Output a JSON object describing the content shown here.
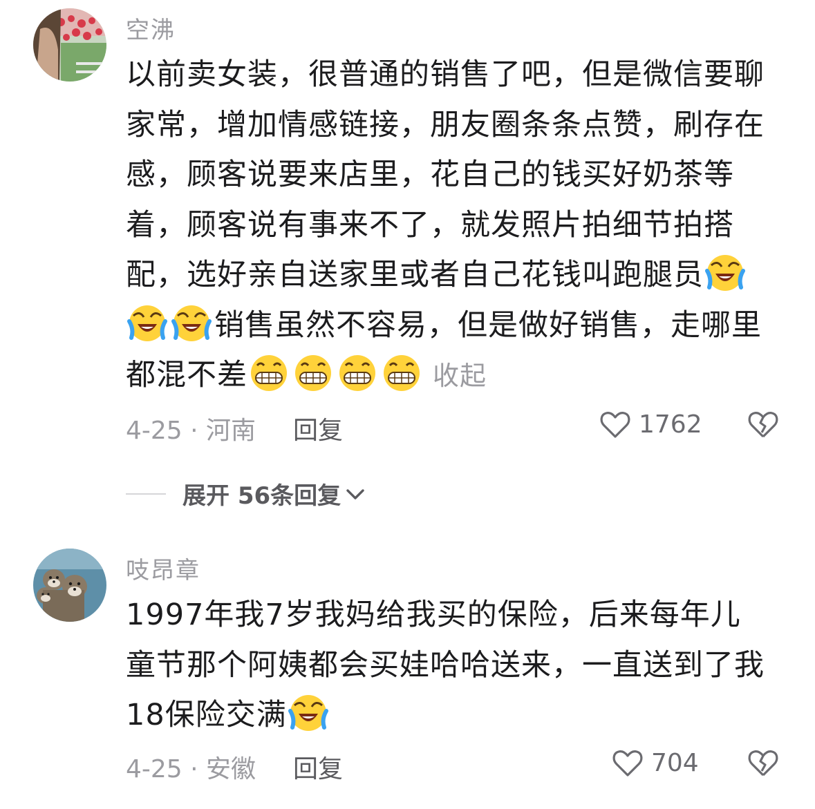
{
  "comments": [
    {
      "username": "空沸",
      "text_parts": [
        "以前卖女装，很普通的销售了吧，但是微信要聊家常，增加情感链接，朋友圈条条点赞，刷存在感，顾客说要来店里，花自己的钱买好奶茶等着，顾客说有事来不了，就发照片拍细节拍搭配，选好亲自送家里或者自己花钱叫跑腿员",
        "销售虽然不容易，但是做好销售，走哪里都混不差"
      ],
      "emojis": [
        "laugh-cry-emoji",
        "laugh-cry-emoji",
        "laugh-cry-emoji",
        "grin-emoji",
        "grin-emoji",
        "grin-emoji",
        "grin-emoji"
      ],
      "collapse_label": "收起",
      "date_location": "4-25 · 河南",
      "reply_label": "回复",
      "likes": "1762"
    },
    {
      "username": "吱昂章",
      "text": "1997年我7岁我妈给我买的保险，后来每年儿童节那个阿姨都会买娃哈哈送来，一直送到了我18保险交满",
      "emojis": [
        "laugh-cry-emoji"
      ],
      "date_location": "4-25 · 安徽",
      "reply_label": "回复",
      "likes": "704"
    }
  ],
  "expand_replies_label": "展开 56条回复",
  "colors": {
    "secondary_text": "#9b9ba0",
    "primary_text": "#1c1c1e",
    "emoji_face": "#ffd23a",
    "emoji_tears": "#3aa2f0"
  }
}
